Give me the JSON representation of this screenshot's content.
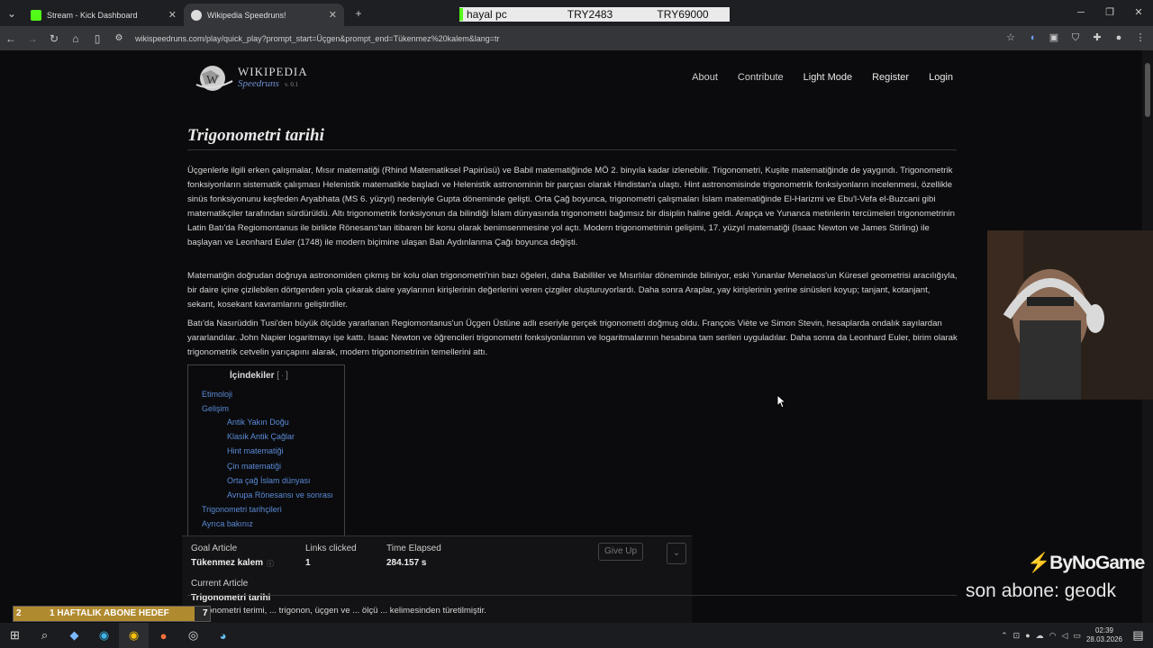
{
  "browser": {
    "tabs": [
      {
        "title": "Stream - Kick Dashboard",
        "favicon_color": "#53fc18"
      },
      {
        "title": "Wikipedia Speedruns!",
        "favicon_color": "#dddddd"
      }
    ],
    "url": "wikispeedruns.com/play/quick_play?prompt_start=Üçgen&prompt_end=Tükenmez%20kalem&lang=tr"
  },
  "stream_bar": {
    "left": "hayal pc",
    "mid": "TRY2483",
    "right": "TRY69000"
  },
  "site": {
    "logo_title": "WIKIPEDIA",
    "logo_sub": "Speedruns",
    "version": "v. 0.1",
    "nav": [
      "About",
      "Contribute",
      "Light Mode",
      "Register",
      "Login"
    ]
  },
  "article": {
    "title": "Trigonometri tarihi",
    "paragraphs": [
      "Üçgenlerle ilgili erken çalışmalar, Mısır matematiği (Rhind Matematiksel Papirüsü) ve Babil matematiğinde MÖ 2. binyıla kadar izlenebilir. Trigonometri, Kuşite matematiğinde de yaygındı. Trigonometrik fonksiyonların sistematik çalışması Helenistik matematikle başladı ve Helenistik astronominin bir parçası olarak Hindistan'a ulaştı. Hint astronomisinde trigonometrik fonksiyonların incelenmesi, özellikle sinüs fonksiyonunu keşfeden Aryabhata (MS 6. yüzyıl) nedeniyle Gupta döneminde gelişti. Orta Çağ boyunca, trigonometri çalışmaları İslam matematiğinde El-Harizmi ve Ebu'l-Vefa el-Buzcani gibi matematikçiler tarafından sürdürüldü. Altı trigonometrik fonksiyonun da bilindiği İslam dünyasında trigonometri bağımsız bir disiplin haline geldi. Arapça ve Yunanca metinlerin tercümeleri trigonometrinin Latin Batı'da Regiomontanus ile birlikte Rönesans'tan itibaren bir konu olarak benimsenmesine yol açtı. Modern trigonometrinin gelişimi, 17. yüzyıl matematiği (Isaac Newton ve James Stirling) ile başlayan ve Leonhard Euler (1748) ile modern biçimine ulaşan Batı Aydınlanma Çağı boyunca değişti.",
      "Matematiğin doğrudan doğruya astronomiden çıkmış bir kolu olan trigonometri'nin bazı öğeleri, daha Babilliler ve Mısırlılar döneminde biliniyor, eski Yunanlar Menelaos'un Küresel geometrisi aracılığıyla, bir daire içine çizilebilen dörtgenden yola çıkarak daire yaylarının kirişlerinin değerlerini veren çizgiler oluşturuyorlardı. Daha sonra Araplar, yay kirişlerinin yerine sinüsleri koyup; tanjant, kotanjant, sekant, kosekant kavramlarını geliştirdiler.",
      "Batı'da Nasırüddin Tusi'den büyük ölçüde yararlanan Regiomontanus'un Üçgen Üstüne adlı eseriyle gerçek trigonometri doğmuş oldu. François Viète ve Simon Stevin, hesaplarda ondalık sayılardan yararlandılar. John Napier logaritmayı işe kattı. Isaac Newton ve öğrencileri trigonometri fonksiyonlarının ve logaritmalarının hesabına tam serileri uyguladılar. Daha sonra da Leonhard Euler, birim olarak trigonometrik cetvelin yarıçapını alarak, modern trigonometrinin temellerini attı."
    ],
    "toc": {
      "title": "İçindekiler",
      "items": [
        "Etimoloji",
        "Gelişim",
        "Antik Yakın Doğu",
        "Klasik Antik Çağlar",
        "Hint matematiği",
        "Çin matematiği",
        "Orta çağ İslam dünyası",
        "Avrupa Rönesansı ve sonrası",
        "Trigonometri tarihçileri",
        "Ayrıca bakınız"
      ]
    },
    "etymology_snippet": "Trigonometri terimi, ... trigonon, üçgen ve ... ölçü ... kelimesinden türetilmiştir."
  },
  "game": {
    "goal_label": "Goal Article",
    "goal_value": "Tükenmez kalem",
    "links_label": "Links clicked",
    "links_value": "1",
    "time_label": "Time Elapsed",
    "time_value": "284.157 s",
    "current_label": "Current Article",
    "current_value": "Trigonometri tarihi",
    "give_up": "Give Up"
  },
  "overlay": {
    "brand": "ByNoGame",
    "last_sub": "son abone: geodk",
    "goal_prefix": "2",
    "goal_text": "1 HAFTALIK ABONE HEDEF",
    "goal_suffix": "7",
    "goal_progress": 0.92
  },
  "taskbar": {
    "time": "02:39",
    "date": "28.03.2026"
  }
}
